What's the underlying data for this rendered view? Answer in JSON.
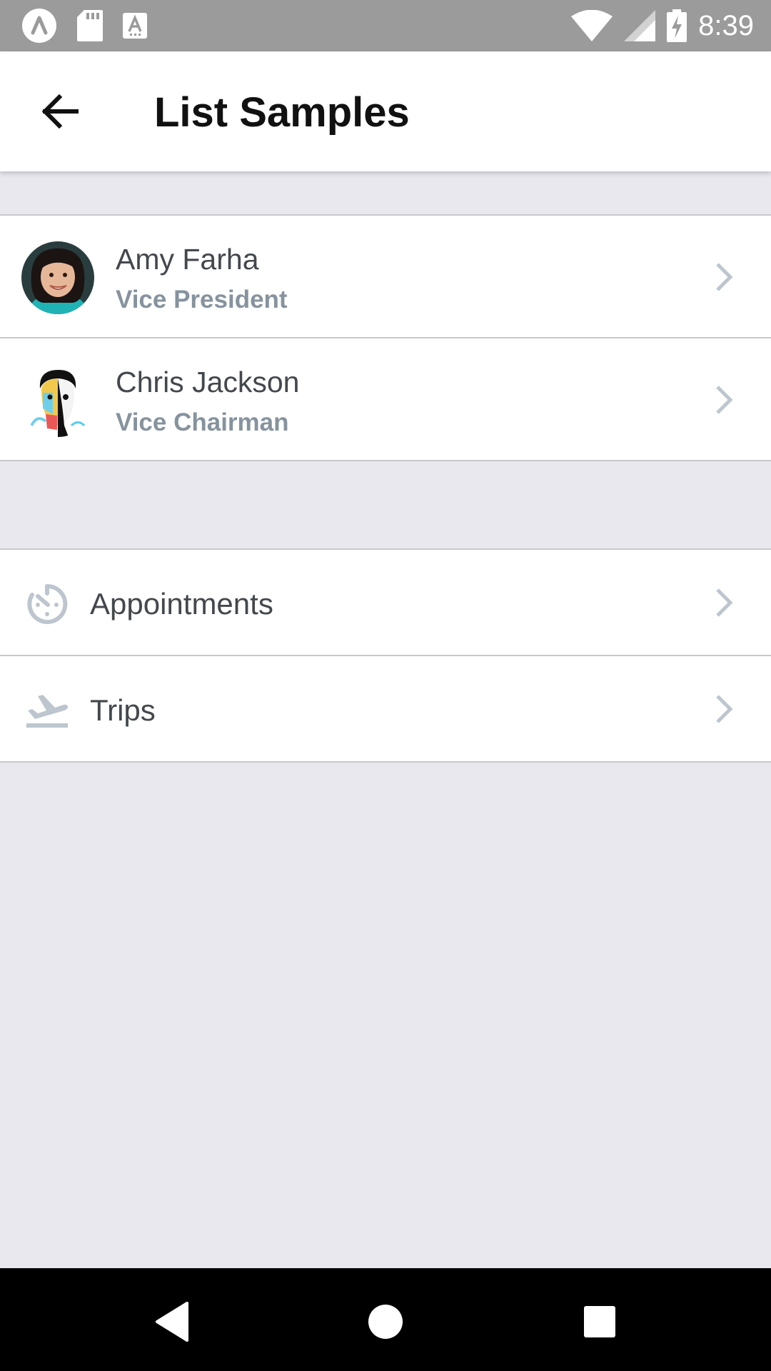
{
  "status_bar": {
    "time": "8:39",
    "left_icons": [
      "assistant-icon",
      "sd-card-icon",
      "font-a-icon"
    ],
    "right_icons": [
      "wifi-icon",
      "signal-icon",
      "battery-charging-icon"
    ]
  },
  "app_bar": {
    "title": "List Samples",
    "back_icon": "arrow-left-icon"
  },
  "people": [
    {
      "name": "Amy Farha",
      "subtitle": "Vice President",
      "avatar": "avatar-photo"
    },
    {
      "name": "Chris Jackson",
      "subtitle": "Vice Chairman",
      "avatar": "avatar-illustration"
    }
  ],
  "items": [
    {
      "label": "Appointments",
      "icon": "timer-icon"
    },
    {
      "label": "Trips",
      "icon": "flight-takeoff-icon"
    }
  ],
  "colors": {
    "background": "#e9e8ee",
    "row_background": "#ffffff",
    "divider": "#c8c7cc",
    "title_text": "#43484d",
    "subtitle_text": "#86939e",
    "icon_gray": "#bdc6cf",
    "status_bar": "#9b9b9b",
    "nav_bar": "#000000"
  },
  "nav_bar": {
    "buttons": [
      "back-triangle-icon",
      "home-circle-icon",
      "recents-square-icon"
    ]
  }
}
